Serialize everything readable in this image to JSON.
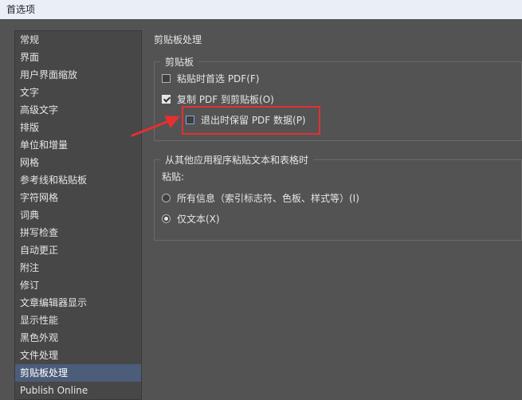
{
  "window": {
    "title": "首选项"
  },
  "sidebar": {
    "selected_index": 20,
    "items": [
      {
        "label": "常规"
      },
      {
        "label": "界面"
      },
      {
        "label": "用户界面缩放"
      },
      {
        "label": "文字"
      },
      {
        "label": "高级文字"
      },
      {
        "label": "排版"
      },
      {
        "label": "单位和增量"
      },
      {
        "label": "网格"
      },
      {
        "label": "参考线和粘贴板"
      },
      {
        "label": "字符网格"
      },
      {
        "label": "词典"
      },
      {
        "label": "拼写检查"
      },
      {
        "label": "自动更正"
      },
      {
        "label": "附注"
      },
      {
        "label": "修订"
      },
      {
        "label": "文章编辑器显示"
      },
      {
        "label": "显示性能"
      },
      {
        "label": "黑色外观"
      },
      {
        "label": "文件处理"
      },
      {
        "label": "剪贴板处理"
      },
      {
        "label": "Publish Online"
      }
    ]
  },
  "panel": {
    "title": "剪贴板处理",
    "clipboard_group": {
      "title": "剪贴板",
      "prefer_pdf": {
        "label": "粘贴时首选 PDF(F)",
        "checked": false
      },
      "copy_pdf": {
        "label": "复制 PDF 到剪贴板(O)",
        "checked": true
      },
      "retain_pdf": {
        "label": "退出时保留 PDF 数据(P)",
        "checked": false
      }
    },
    "paste_group": {
      "title": "从其他应用程序粘贴文本和表格时",
      "paste_label": "粘贴:",
      "all_info": {
        "label": "所有信息（索引标志符、色板、样式等）(I)",
        "selected": false
      },
      "text_only": {
        "label": "仅文本(X)",
        "selected": true
      }
    }
  },
  "annotation": {
    "color": "#e43030"
  }
}
